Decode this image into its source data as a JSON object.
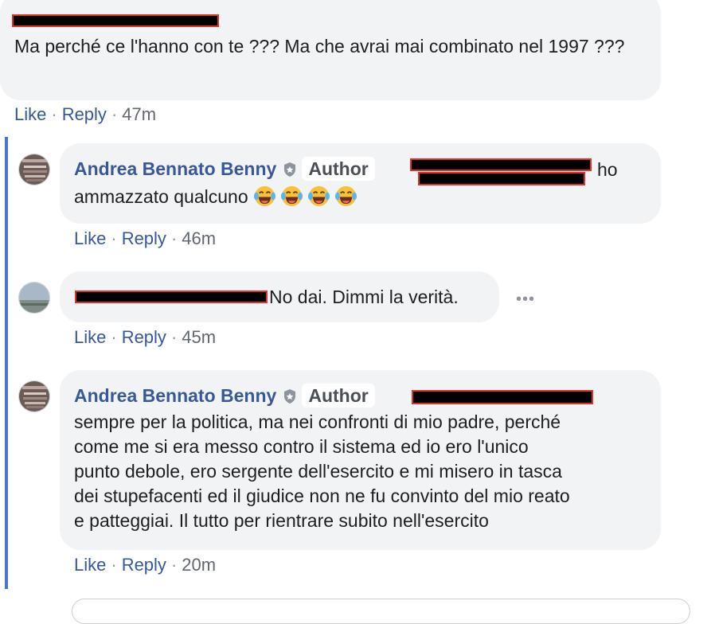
{
  "comment_top": {
    "text": "Ma perché ce l'hanno con te ??? Ma che avrai mai combinato nel 1997 ???",
    "actions": {
      "like": "Like",
      "reply": "Reply",
      "time": "47m"
    }
  },
  "reply1": {
    "author": "Andrea Bennato Benny",
    "badge": "Author",
    "text_after_redaction": "ho",
    "text": "ammazzato qualcuno",
    "actions": {
      "like": "Like",
      "reply": "Reply",
      "time": "46m"
    }
  },
  "reply2": {
    "text": "No dai. Dimmi la verità.",
    "actions": {
      "like": "Like",
      "reply": "Reply",
      "time": "45m"
    }
  },
  "reply3": {
    "author": "Andrea Bennato Benny",
    "badge": "Author",
    "lines": [
      "sempre per la politica, ma nei confronti di mio padre, perché",
      "come me si era messo contro il sistema ed io ero l'unico",
      "punto debole, ero sergente dell'esercito e mi misero in tasca",
      "dei stupefacenti ed il giudice non ne fu convinto del mio reato",
      "e patteggiai. Il tutto per rientrare subito nell'esercito"
    ],
    "actions": {
      "like": "Like",
      "reply": "Reply",
      "time": "20m"
    }
  },
  "colors": {
    "link": "#385898",
    "bubble": "#f2f3f5",
    "thread_line": "#4a76c9",
    "redaction_border": "#e0312a"
  },
  "icons": {
    "more": "more-horizontal-icon",
    "author_shield": "shield-icon",
    "emoji": "laughing-tears-emoji-icon"
  }
}
